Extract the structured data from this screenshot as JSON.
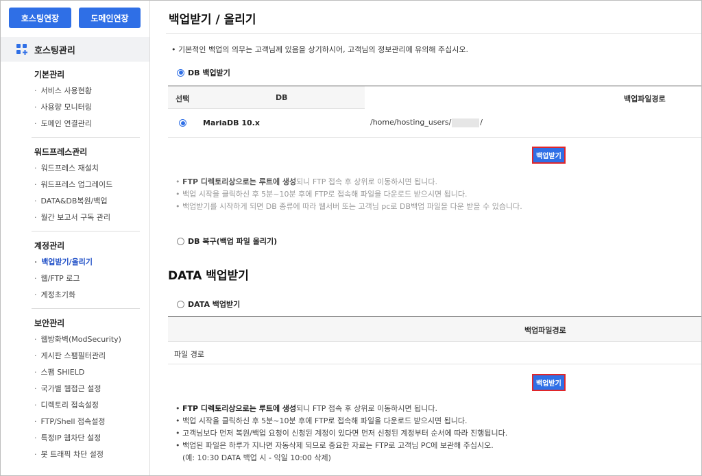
{
  "sidebar": {
    "hosting_extend": "호스팅연장",
    "domain_extend": "도메인연장",
    "menu_title": "호스팅관리",
    "groups": [
      {
        "title": "기본관리",
        "items": [
          "서비스 사용현황",
          "사용량 모니터링",
          "도메인 연결관리"
        ]
      },
      {
        "title": "워드프레스관리",
        "items": [
          "워드프레스 재설치",
          "워드프레스 업그레이드",
          "DATA&DB복원/백업",
          "월간 보고서 구독 관리"
        ]
      },
      {
        "title": "계정관리",
        "items": [
          "백업받기/올리기",
          "웹/FTP 로그",
          "계정초기화"
        ]
      },
      {
        "title": "보안관리",
        "items": [
          "웹방화벽(ModSecurity)",
          "게시판 스팸필터관리",
          "스팸 SHIELD",
          "국가별 웹접근 설정",
          "디렉토리 접속설정",
          "FTP/Shell 접속설정",
          "특정IP 웹차단 설정",
          "봇 트래픽 차단 설정"
        ]
      }
    ],
    "active_item": "백업받기/올리기"
  },
  "main": {
    "title": "백업받기 / 올리기",
    "notice": "기본적인 백업의 의무는 고객님께 있음을 상기하시어, 고객님의 정보관리에 유의해 주십시오.",
    "db_backup_radio": "DB 백업받기",
    "db_table": {
      "headers": [
        "선택",
        "DB",
        "백업파일경로"
      ],
      "row": {
        "db": "MariaDB 10.x",
        "path_prefix": "/home/hosting_users/",
        "path_suffix": "/"
      }
    },
    "download_button": "백업받기",
    "db_notes": [
      {
        "bold": "FTP 디렉토리상으로는 루트에 생성",
        "rest": "되니 FTP 접속 후 상위로 이동하시면 됩니다."
      },
      {
        "bold": "",
        "rest": "백업 시작을 클릭하신 후 5분~10분 후에 FTP로 접속해 파일을 다운로드 받으시면 됩니다."
      },
      {
        "bold": "",
        "rest": "백업받기를 시작하게 되면 DB 종류에 따라 웹서버 또는 고객님 pc로 DB백업 파일을 다운 받을 수 있습니다."
      }
    ],
    "db_restore_radio": "DB 복구(백업 파일 올리기)",
    "data_section_title": "DATA 백업받기",
    "data_backup_radio": "DATA 백업받기",
    "data_table": {
      "header": "백업파일경로",
      "row_label": "파일 경로"
    },
    "data_download_button": "백업받기",
    "data_notes": [
      {
        "bold": "FTP 디렉토리상으로는 루트에 생성",
        "rest": "되니 FTP 접속 후 상위로 이동하시면 됩니다."
      },
      {
        "bold": "",
        "rest": "백업 시작을 클릭하신 후 5분~10분 후에 FTP로 접속해 파일을 다운로드 받으시면 됩니다."
      },
      {
        "bold": "",
        "rest": "고객님보다 먼저 복원/백업 요청이 신청된 계정이 있다면 먼저 신청된 계정부터 순서에 따라 진행됩니다."
      },
      {
        "bold": "",
        "rest": "백업된 파일은 하루가 지나면 자동삭제 되므로 중요한 자료는 FTP로 고객님 PC에 보관해 주십시오."
      }
    ],
    "data_note_example": "(예: 10:30 DATA 백업 시 - 익일 10:00 삭제)"
  },
  "colors": {
    "accent": "#2f6fe6",
    "highlight_box": "#e0262a",
    "active_text": "#1f4fc7"
  }
}
